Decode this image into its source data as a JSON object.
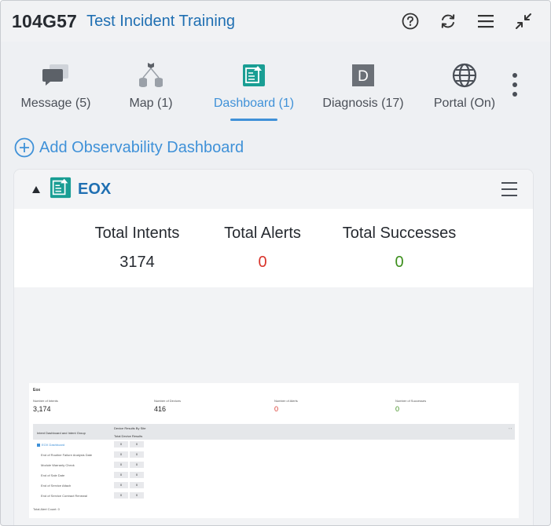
{
  "header": {
    "incident_id": "104G57",
    "incident_title": "Test Incident Training",
    "icons": [
      "help-icon",
      "refresh-icon",
      "menu-icon",
      "collapse-icon"
    ]
  },
  "tabs": [
    {
      "label": "Message (5)",
      "icon": "message-icon",
      "active": false
    },
    {
      "label": "Map (1)",
      "icon": "map-icon",
      "active": false
    },
    {
      "label": "Dashboard (1)",
      "icon": "dashboard-icon",
      "active": true
    },
    {
      "label": "Diagnosis (17)",
      "icon": "diagnosis-icon",
      "active": false
    },
    {
      "label": "Portal (On)",
      "icon": "globe-icon",
      "active": false
    }
  ],
  "diagnosis_letter": "D",
  "add_dashboard_label": "Add Observability Dashboard",
  "card": {
    "title": "EOX",
    "stats": [
      {
        "label": "Total Intents",
        "value": "3174",
        "color": "#262a30"
      },
      {
        "label": "Total Alerts",
        "value": "0",
        "color": "#d9342b"
      },
      {
        "label": "Total Successes",
        "value": "0",
        "color": "#3d8f1d"
      }
    ]
  },
  "thumbnail": {
    "title": "Eox",
    "stats": [
      {
        "label": "Number of Intents",
        "value": "3,174",
        "color": "#222222"
      },
      {
        "label": "Number of Devices",
        "value": "416",
        "color": "#222222"
      },
      {
        "label": "Number of Alerts",
        "value": "0",
        "color": "#d9342b"
      },
      {
        "label": "Number of Successes",
        "value": "0",
        "color": "#3d8f1d"
      }
    ],
    "table": {
      "col_group": "Intent Dashboard and Intent Group",
      "col_site": "Device Results By Site",
      "col_total": "Total Device Results",
      "pager": "‹  ›",
      "rows": [
        {
          "label": "EOX Dashboard",
          "a": "0",
          "b": "0",
          "link": true
        },
        {
          "label": "End of Routine Failure Analysis Date",
          "a": "0",
          "b": "0",
          "link": false
        },
        {
          "label": "Module Warranty Check",
          "a": "0",
          "b": "0",
          "link": false
        },
        {
          "label": "End of Sale Date",
          "a": "0",
          "b": "0",
          "link": false
        },
        {
          "label": "End of Service Attach",
          "a": "0",
          "b": "0",
          "link": false
        },
        {
          "label": "End of Service Contract Renewal",
          "a": "0",
          "b": "0",
          "link": false
        }
      ],
      "footer": "Total Alert Count: 0"
    }
  }
}
